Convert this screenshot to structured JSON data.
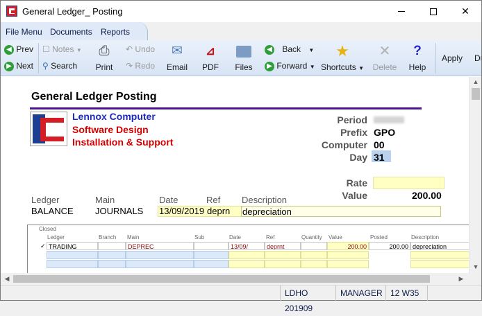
{
  "window": {
    "title": "General Ledger_ Posting"
  },
  "menu": {
    "items": [
      "File Menu",
      "Documents",
      "Reports"
    ]
  },
  "toolbar": {
    "prev": "Prev",
    "next": "Next",
    "notes": "Notes",
    "search": "Search",
    "print": "Print",
    "undo": "Undo",
    "redo": "Redo",
    "email": "Email",
    "pdf": "PDF",
    "files": "Files",
    "back": "Back",
    "forward": "Forward",
    "shortcuts": "Shortcuts",
    "delete": "Delete",
    "help": "Help",
    "apply": "Apply",
    "du": "Du"
  },
  "form": {
    "heading": "General Ledger Posting",
    "company": {
      "line1": "Lennox Computer",
      "line2": "Software Design",
      "line3": "Installation & Support"
    },
    "period_label": "Period",
    "prefix_label": "Prefix",
    "prefix_value": "GPO",
    "computer_label": "Computer",
    "computer_value": "00",
    "day_label": "Day",
    "day_value": "31",
    "rate_label": "Rate",
    "value_label": "Value",
    "value_value": "200.00",
    "fields": {
      "ledger_label": "Ledger",
      "ledger_value": "BALANCE",
      "main_label": "Main",
      "main_value": "JOURNALS",
      "date_label": "Date",
      "date_value": "13/09/2019",
      "ref_label": "Ref",
      "ref_value": "deprn",
      "description_label": "Description",
      "description_value": "depreciation"
    }
  },
  "grid": {
    "columns": [
      "Closed",
      "Ledger",
      "Branch",
      "Main",
      "Sub",
      "Date",
      "Ref",
      "Quantity",
      "Value",
      "Posted",
      "Description"
    ],
    "rows": [
      {
        "check": "✓",
        "ledger": "TRADING",
        "branch": "",
        "main": "DEPREC",
        "sub": "",
        "date": "13/09/",
        "ref": "deprnt",
        "quantity": "",
        "value": "200.00",
        "posted": "200.00",
        "description": "depreciation"
      }
    ]
  },
  "status": {
    "ledger": "LDHO 201909",
    "user": "MANAGER",
    "week": "12 W35"
  },
  "colors": {
    "heading_rule": "#4a1490",
    "company_blue": "#1a2ac2",
    "company_red": "#d20000",
    "input_yellow": "#ffffc4",
    "input_blue": "#dbe9f8"
  }
}
